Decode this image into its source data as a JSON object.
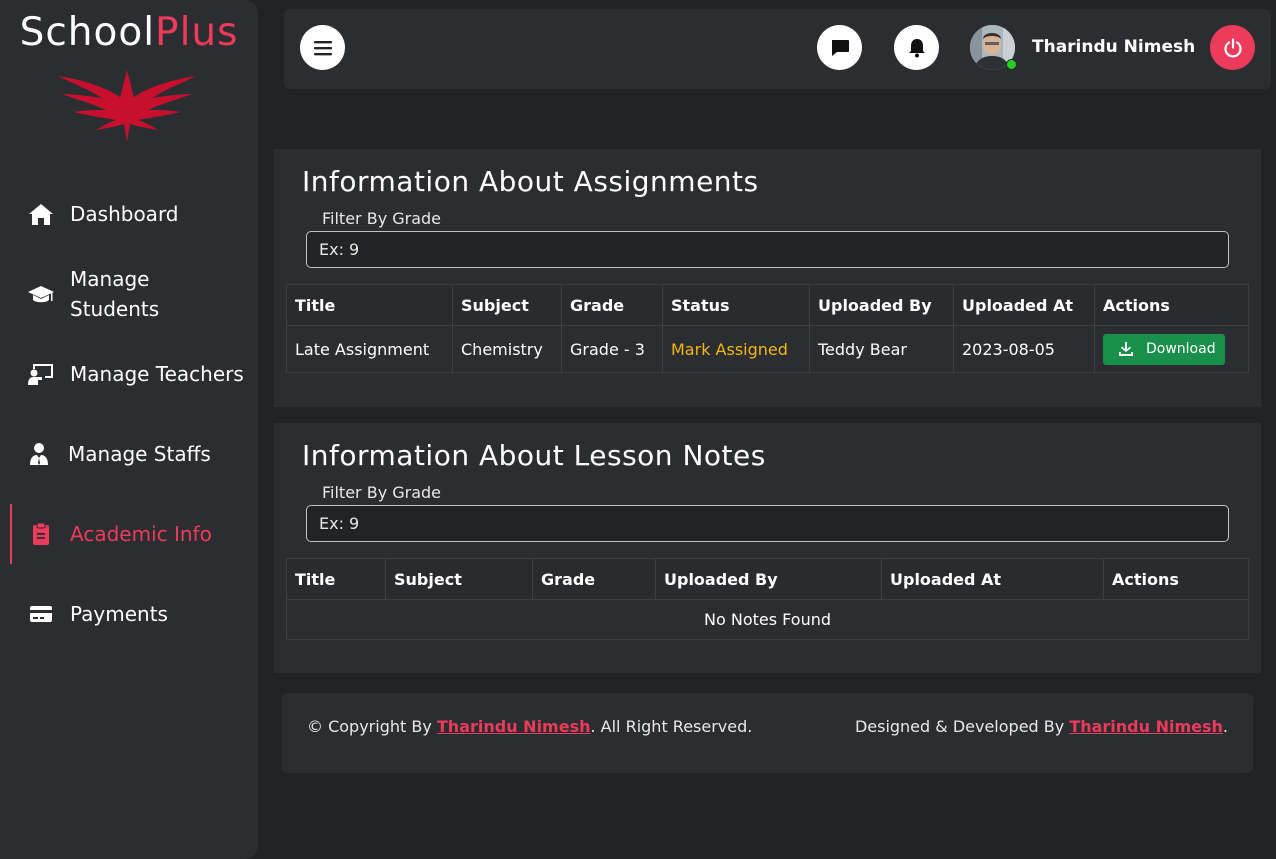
{
  "brand": {
    "name_part1": "School",
    "name_part2": "Plus"
  },
  "sidebar": {
    "items": [
      {
        "label": "Dashboard",
        "icon": "home-icon"
      },
      {
        "label": "Manage Students",
        "icon": "graduation-cap-icon"
      },
      {
        "label": "Manage Teachers",
        "icon": "chalkboard-teacher-icon"
      },
      {
        "label": "Manage Staffs",
        "icon": "user-tie-icon"
      },
      {
        "label": "Academic Info",
        "icon": "clipboard-icon",
        "active": true
      },
      {
        "label": "Payments",
        "icon": "credit-card-icon"
      }
    ]
  },
  "topbar": {
    "user_name": "Tharindu Nimesh",
    "icons": [
      "menu-icon",
      "message-icon",
      "bell-icon",
      "power-icon"
    ]
  },
  "assignments": {
    "title": "Information About Assignments",
    "filter_label": "Filter By Grade",
    "filter_placeholder": "Ex: 9",
    "columns": [
      "Title",
      "Subject",
      "Grade",
      "Status",
      "Uploaded By",
      "Uploaded At",
      "Actions"
    ],
    "rows": [
      {
        "title": "Late Assignment",
        "subject": "Chemistry",
        "grade": "Grade - 3",
        "status": "Mark Assigned",
        "uploaded_by": "Teddy Bear",
        "uploaded_at": "2023-08-05",
        "action": "Download"
      }
    ]
  },
  "lesson_notes": {
    "title": "Information About Lesson Notes",
    "filter_label": "Filter By Grade",
    "filter_placeholder": "Ex: 9",
    "columns": [
      "Title",
      "Subject",
      "Grade",
      "Uploaded By",
      "Uploaded At",
      "Actions"
    ],
    "empty_message": "No Notes Found"
  },
  "footer": {
    "left_prefix": "© Copyright By ",
    "left_link": "Tharindu Nimesh",
    "left_suffix": ". All Right Reserved.",
    "right_prefix": "Designed & Developed By ",
    "right_link": "Tharindu Nimesh",
    "right_suffix": "."
  },
  "colors": {
    "accent": "#ec3b5b",
    "status_warning": "#f1b715",
    "download_green": "#188f4a",
    "online": "#21d11d"
  }
}
